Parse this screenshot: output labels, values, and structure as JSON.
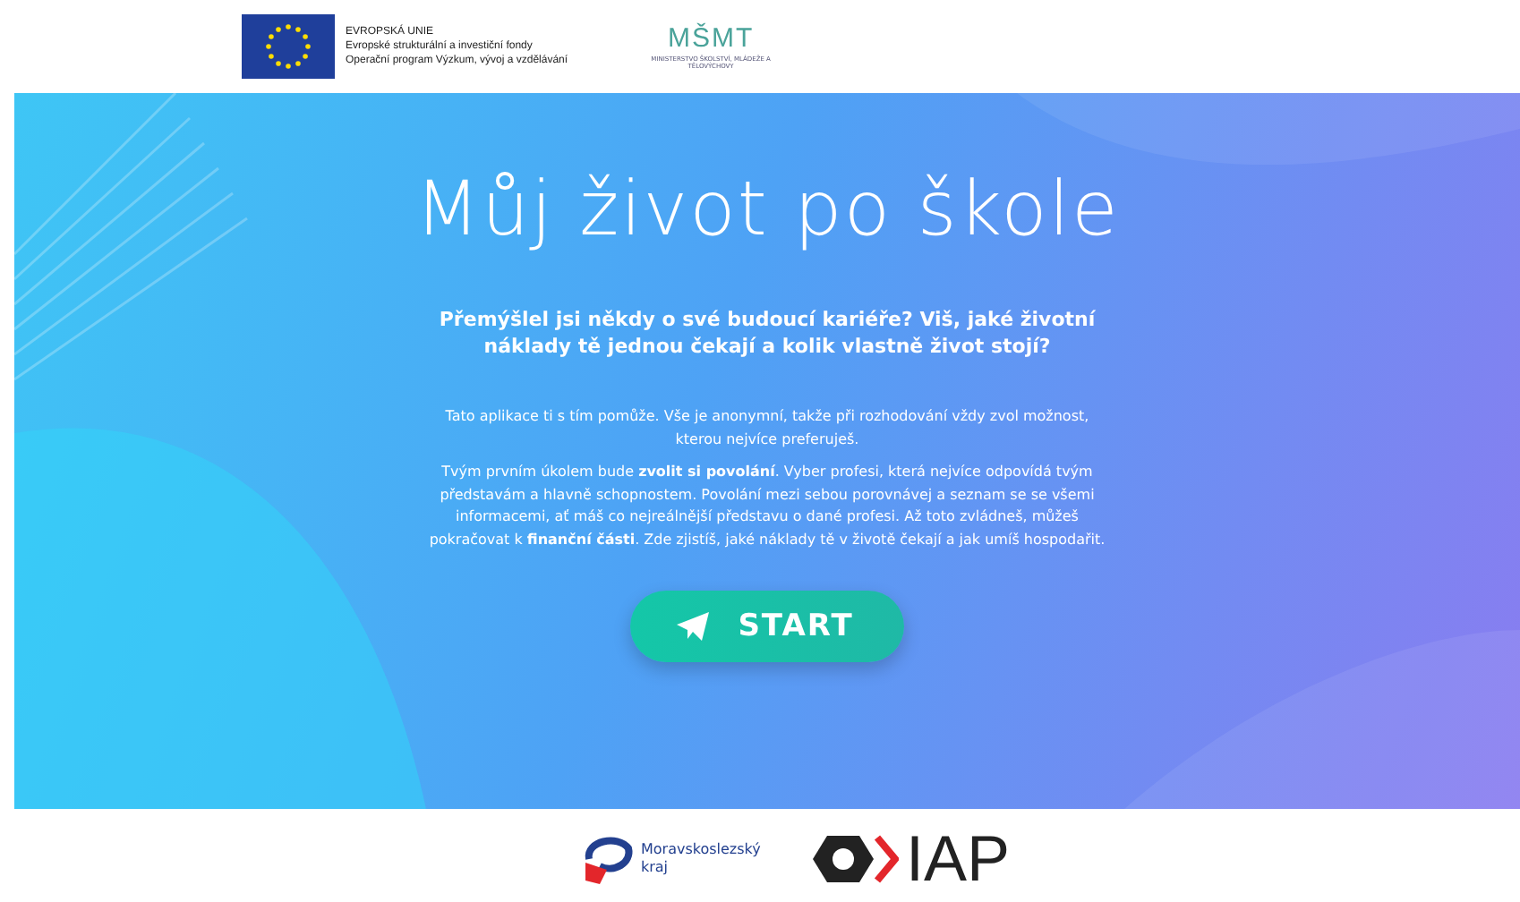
{
  "header": {
    "eu_logo": {
      "lines": [
        "EVROPSKÁ UNIE",
        "Evropské strukturální a investiční fondy",
        "Operační program Výzkum, vývoj a vzdělávání"
      ]
    },
    "msmt_logo": {
      "mark": "MŠMT",
      "caption": "MINISTERSTVO ŠKOLSTVÍ, MLÁDEŽE A TĚLOVÝCHOVY"
    }
  },
  "hero": {
    "title": "Můj život po škole",
    "lead": "Přemýšlel jsi někdy o své budoucí kariéře? Viš, jaké životní náklady tě jednou čekají a kolik vlastně život stojí?",
    "paragraphs": [
      "Tato aplikace ti s tím pomůže. Vše je anonymní, takže při rozhodování vždy zvol možnost, kterou nejvíce preferuješ.",
      "Tvým prvním úkolem bude **zvolit si povolání**. Vyber profesi, která nejvíce odpovídá tvým představám a hlavně schopnostem. Povolání mezi sebou porovnávej a seznam se se všemi informacemi, ať máš co nejreálnější představu o dané profesi. Až toto zvládneš, můžeš pokračovat k **finanční části**. Zde zjistíš, jaké náklady tě v životě čekají a jak umíš hospodařit."
    ],
    "button": "START"
  },
  "footer": {
    "region_logo": "Moravskoslezský kraj",
    "iap_logo": "IAP"
  }
}
